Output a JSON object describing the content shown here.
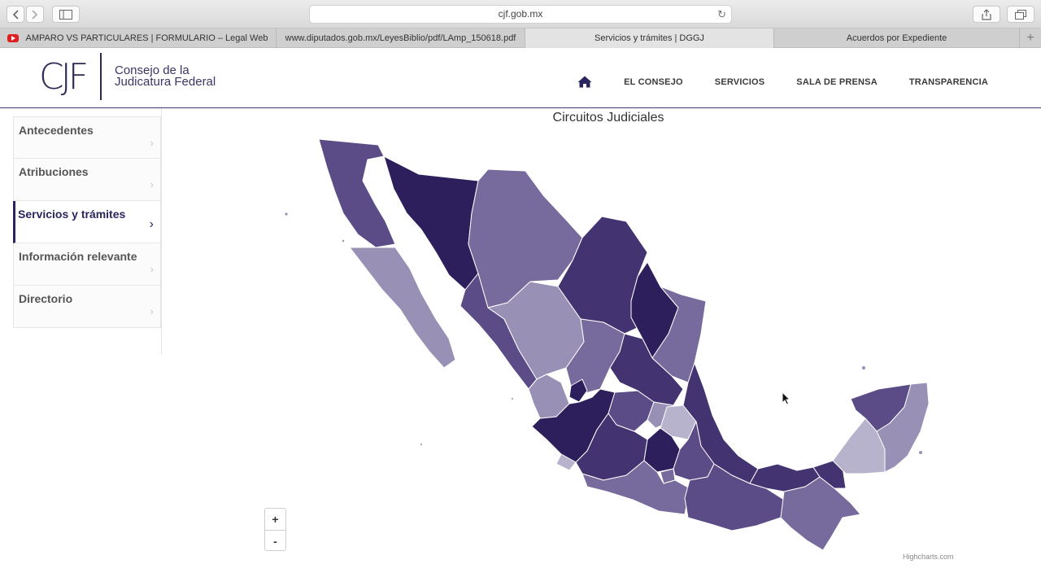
{
  "browser": {
    "url": "cjf.gob.mx",
    "tabs": [
      {
        "label": "AMPARO VS PARTICULARES | FORMULARIO – Legal Web",
        "active": false,
        "icon": "youtube-icon"
      },
      {
        "label": "www.diputados.gob.mx/LeyesBiblio/pdf/LAmp_150618.pdf",
        "active": false
      },
      {
        "label": "Servicios y trámites | DGGJ",
        "active": true
      },
      {
        "label": "Acuerdos por Expediente",
        "active": false
      }
    ],
    "new_tab": "+"
  },
  "header": {
    "logo_mark": "CJF",
    "logo_line1": "Consejo de la",
    "logo_line2": "Judicatura Federal",
    "nav": {
      "home_icon": "home-icon",
      "items": [
        "EL CONSEJO",
        "SERVICIOS",
        "SALA DE PRENSA",
        "TRANSPARENCIA"
      ]
    }
  },
  "sidebar": {
    "items": [
      {
        "label": "Antecedentes",
        "active": false
      },
      {
        "label": "Atribuciones",
        "active": false
      },
      {
        "label": "Servicios y trámites",
        "active": true
      },
      {
        "label": "Información relevante",
        "active": false
      },
      {
        "label": "Directorio",
        "active": false
      }
    ],
    "chevron": "›"
  },
  "map": {
    "title": "Circuitos Judiciales",
    "zoom_in": "+",
    "zoom_out": "-",
    "credit": "Highcharts.com",
    "colors": {
      "c1": "#2d1f5c",
      "c2": "#433371",
      "c3": "#5b4b86",
      "c4": "#766b9c",
      "c5": "#9890b5",
      "c6": "#b8b3cc"
    }
  }
}
